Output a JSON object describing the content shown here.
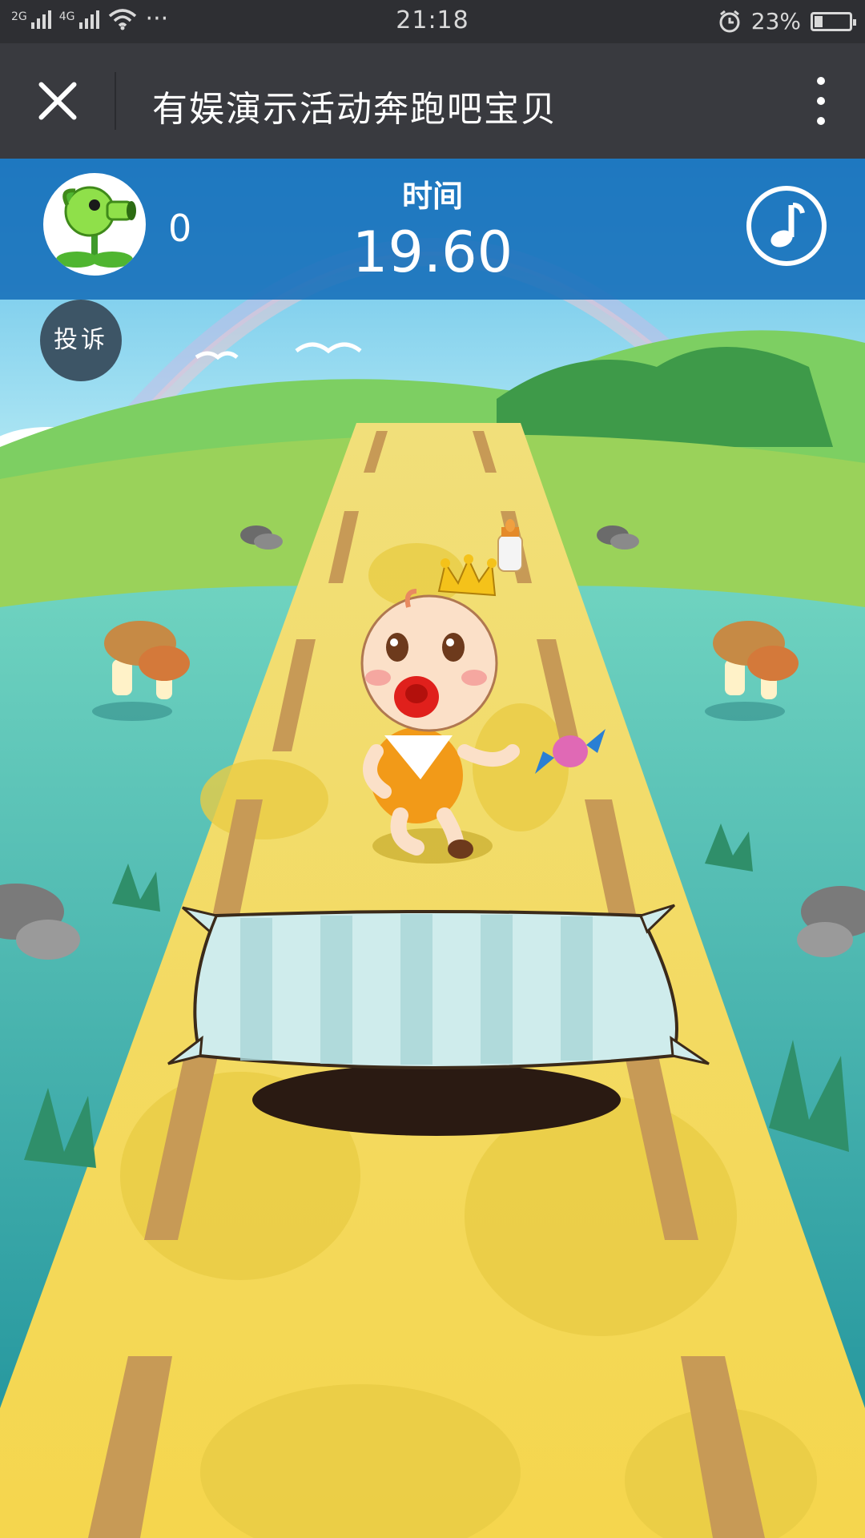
{
  "status_bar": {
    "network1": "2G",
    "network2": "4G",
    "dots": "···",
    "time": "21:18",
    "battery_text": "23%",
    "battery_level": 0.23
  },
  "nav": {
    "title": "有娱演示活动奔跑吧宝贝"
  },
  "game": {
    "score": "0",
    "time_label": "时间",
    "time_value": "19.60",
    "complain_label": "投诉"
  },
  "colors": {
    "hud": "#176eb9",
    "road": "#f5dc5a",
    "grass": "#8fd05a",
    "water": "#3fa7a8",
    "sky": "#7ed3ef"
  },
  "icons": [
    "close-icon",
    "more-icon",
    "music-icon",
    "plant-avatar-icon",
    "alarm-icon",
    "wifi-icon"
  ]
}
